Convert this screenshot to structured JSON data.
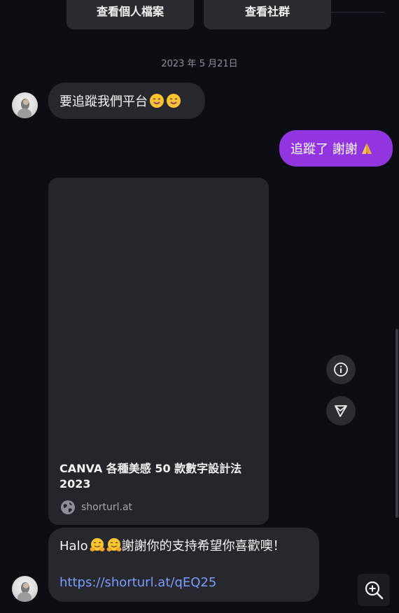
{
  "top_buttons": {
    "view_profile": "查看個人檔案",
    "view_community": "查看社群"
  },
  "date_divider": "2023 年 5 月21日",
  "messages": {
    "incoming_1": {
      "text": "要追蹤我們平台"
    },
    "outgoing_1": {
      "text": "追蹤了 謝謝"
    },
    "card": {
      "title": "CANVA 各種美感 50 款數字設計法 2023",
      "domain": "shorturl.at"
    },
    "incoming_2": {
      "prefix": "Halo",
      "text": "謝謝你的支持希望你喜歡噢！",
      "link": "https://shorturl.at/qEQ25"
    }
  },
  "icons": {
    "info": "info-icon",
    "share": "share-arrow-icon",
    "globe": "globe-icon",
    "zoom": "zoom-in-icon",
    "smile": "smiling-face-emoji",
    "hug": "hugging-face-emoji",
    "pray": "folded-hands-emoji"
  },
  "colors": {
    "background": "#0c0e13",
    "incoming_bubble": "#26282e",
    "outgoing_bubble": "#9035e0",
    "link": "#7d9cff"
  }
}
